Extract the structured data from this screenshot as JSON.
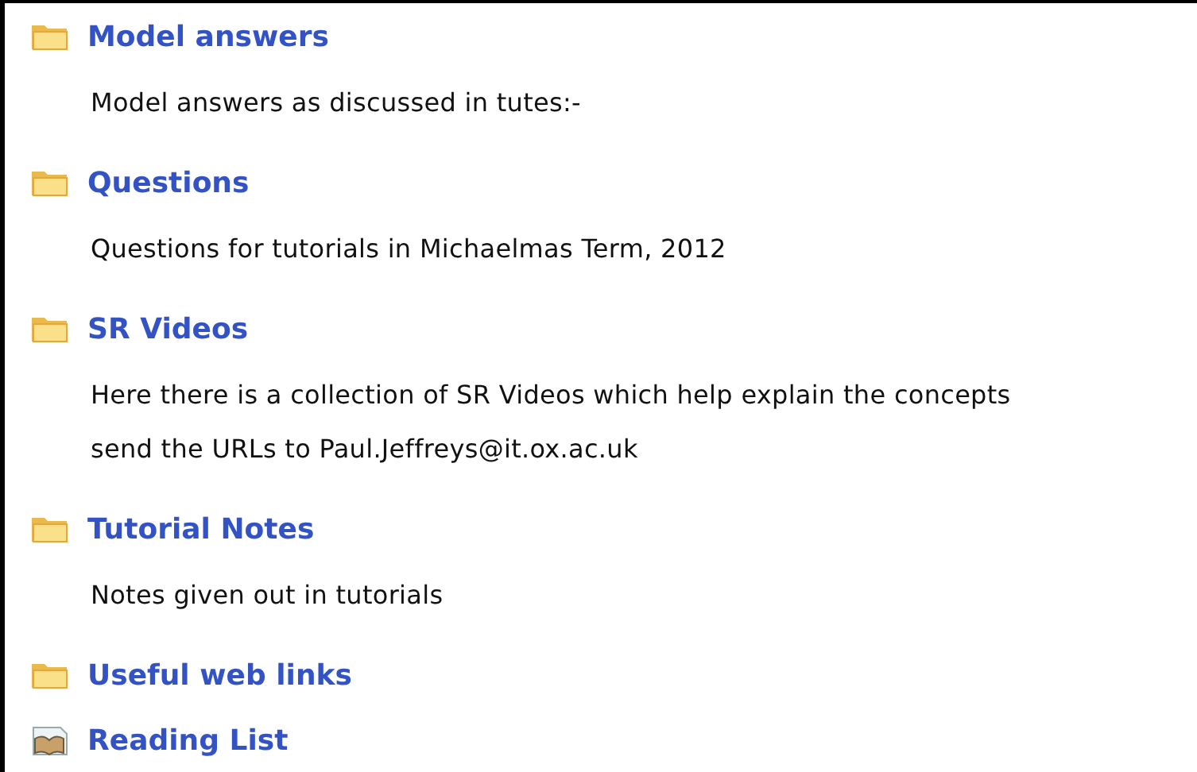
{
  "items": [
    {
      "kind": "folder",
      "title": "Model answers",
      "description": [
        "Model answers as discussed in tutes:-"
      ]
    },
    {
      "kind": "folder",
      "title": "Questions",
      "description": [
        "Questions for tutorials in Michaelmas Term, 2012"
      ]
    },
    {
      "kind": "folder",
      "title": "SR Videos",
      "description": [
        "Here there is a collection of SR Videos which help explain the concepts",
        "send the URLs to Paul.Jeffreys@it.ox.ac.uk"
      ]
    },
    {
      "kind": "folder",
      "title": "Tutorial Notes",
      "description": [
        "Notes given out in tutorials"
      ]
    },
    {
      "kind": "folder",
      "title": "Useful web links"
    },
    {
      "kind": "book",
      "title": "Reading List"
    }
  ]
}
